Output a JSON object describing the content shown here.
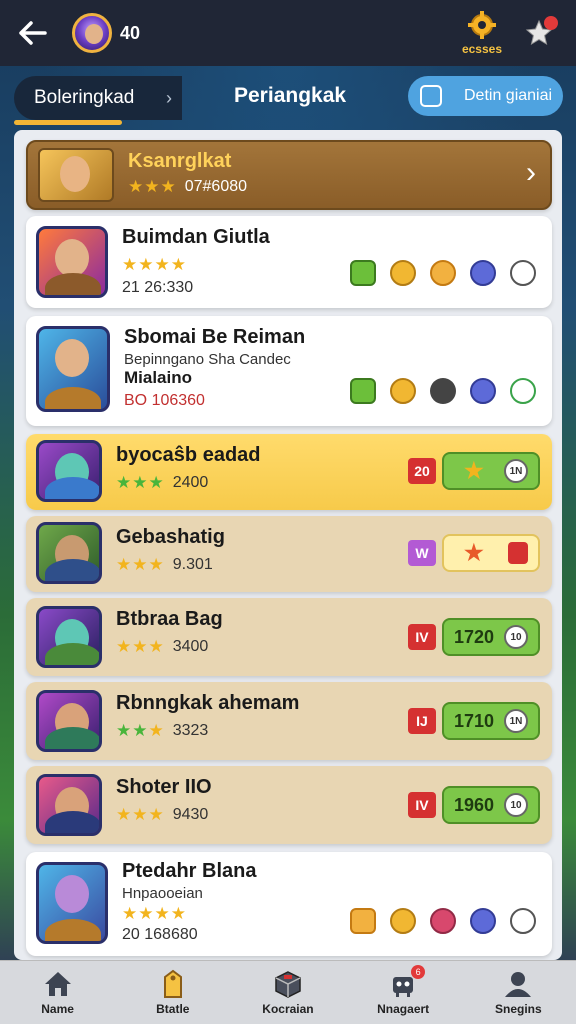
{
  "topbar": {
    "level": "40",
    "settings_label": "ecsses"
  },
  "tabs": {
    "left": "Boleringkad",
    "center": "Periangkak",
    "right": "Detin gianiai"
  },
  "header_row": {
    "title": "Ksanrglkat",
    "score": "07#6080"
  },
  "rows": [
    {
      "title": "Buimdan Giutla",
      "score": "21 26:330"
    },
    {
      "title": "Sbomai Be Reiman",
      "subtitle": "Bepinngano Sha Candec",
      "subtitle2": "Mialaino",
      "score": "BO 106360"
    },
    {
      "title": "byocaŝb eadad",
      "score": "2400",
      "level": "20",
      "pill": "",
      "ball": "1N"
    },
    {
      "title": "Gebashatig",
      "score": "9.301",
      "level": "W",
      "pill": "",
      "ball": ""
    },
    {
      "title": "Btbraa Bag",
      "score": "3400",
      "level": "IV",
      "pill": "1720",
      "ball": "10"
    },
    {
      "title": "Rbnngkak ahemam",
      "score": "3323",
      "level": "IJ",
      "pill": "1710",
      "ball": "1N"
    },
    {
      "title": "Shoter IIO",
      "score": "9430",
      "level": "IV",
      "pill": "1960",
      "ball": "10"
    },
    {
      "title": "Ptedahr Blana",
      "subtitle": "Hnpaooeian",
      "score": "20 168680"
    }
  ],
  "bottom_nav": [
    {
      "label": "Name",
      "icon": "home-icon"
    },
    {
      "label": "Btatle",
      "icon": "tag-icon"
    },
    {
      "label": "Kocraian",
      "icon": "box-icon"
    },
    {
      "label": "Nnagaert",
      "icon": "robot-icon",
      "badge": "6"
    },
    {
      "label": "Snegins",
      "icon": "user-icon"
    }
  ],
  "colors": {
    "accent": "#f2b535",
    "topbar": "#202636",
    "blue_button": "#4fa3e0"
  }
}
